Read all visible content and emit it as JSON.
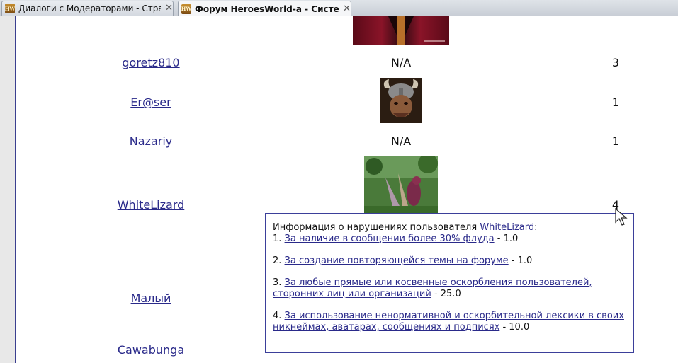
{
  "tabs": [
    {
      "title": "Диалоги с Модераторами - Стран...",
      "favicon": "HW",
      "close": "✕"
    },
    {
      "title": "Форум HeroesWorld-a - Система...",
      "favicon": "HW",
      "close": "✕"
    }
  ],
  "rows": [
    {
      "user": "goretz810",
      "avatar_text": "N/A",
      "count": "3"
    },
    {
      "user": "Er@ser",
      "avatar_text": "",
      "count": "1"
    },
    {
      "user": "Nazariy",
      "avatar_text": "N/A",
      "count": "1"
    },
    {
      "user": "WhiteLizard",
      "avatar_text": "",
      "count": "4"
    },
    {
      "user": "Малый",
      "avatar_text": "",
      "count": ""
    },
    {
      "user": "Cawabunga",
      "avatar_text": "",
      "count": ""
    }
  ],
  "tooltip": {
    "intro": "Информация о нарушениях пользователя ",
    "user": "WhiteLizard",
    "colon": ":",
    "items": [
      {
        "num": "1. ",
        "link": "За наличие в сообщении более 30% флуда",
        "value": " - 1.0"
      },
      {
        "num": "2. ",
        "link": "За создание повторяющейся темы на форуме",
        "value": " - 1.0"
      },
      {
        "num": "3. ",
        "link": "За любые прямые или косвенные оскорбления пользователей, сторонних лиц или организаций",
        "value": " - 25.0"
      },
      {
        "num": "4. ",
        "link": "За использование ненормативной и оскорбительной лексики в своих никнеймах, аватарах, сообщениях и подписях",
        "value": " - 10.0"
      }
    ]
  },
  "colors": {
    "link": "#2a2a8a",
    "border": "#3b3f9a"
  },
  "icons": {
    "cursor": "arrow-cursor-icon",
    "favicon": "heroes-world-favicon"
  }
}
